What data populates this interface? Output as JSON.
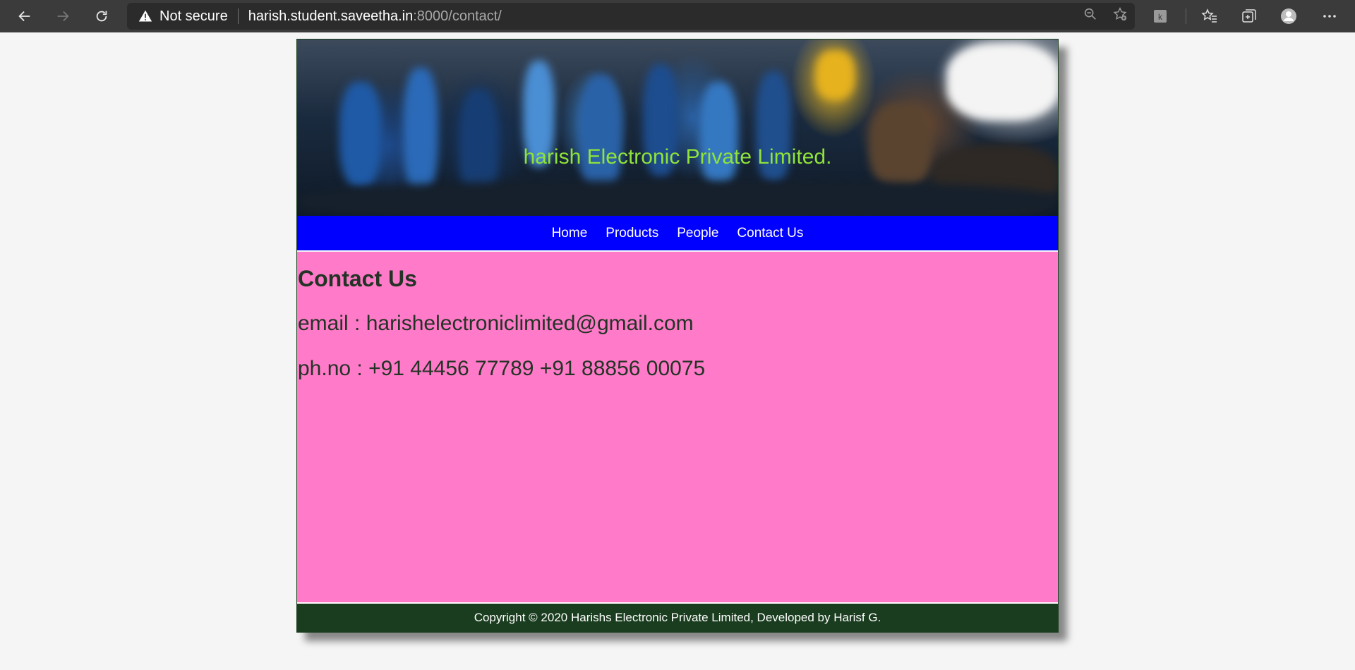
{
  "browser": {
    "security_label": "Not secure",
    "url_host": "harish.student.saveetha.in",
    "url_path": ":8000/contact/"
  },
  "site": {
    "banner_title": "harish Electronic Private Limited.",
    "nav": {
      "home": "Home",
      "products": "Products",
      "people": "People",
      "contact": "Contact Us"
    },
    "content": {
      "heading": "Contact Us",
      "email": "email : harishelectroniclimited@gmail.com",
      "phone": "ph.no : +91 44456 77789 +91 88856 00075"
    },
    "footer": "Copyright © 2020 Harishs Electronic Private Limited, Developed by Harisf G."
  },
  "colors": {
    "chrome_bg": "#3b3b3b",
    "nav_bg": "#0000ff",
    "content_bg": "#ff7ac8",
    "footer_bg": "#1a3d1f",
    "banner_title": "#8fe33a"
  },
  "icons": {
    "back": "back-arrow-icon",
    "forward": "forward-arrow-icon",
    "refresh": "refresh-icon",
    "warning": "warning-icon",
    "zoom": "zoom-out-icon",
    "add_favorite": "add-favorite-icon",
    "extension": "extension-icon",
    "favorites": "favorites-icon",
    "collections": "collections-icon",
    "profile": "profile-avatar-icon",
    "menu": "more-menu-icon"
  }
}
